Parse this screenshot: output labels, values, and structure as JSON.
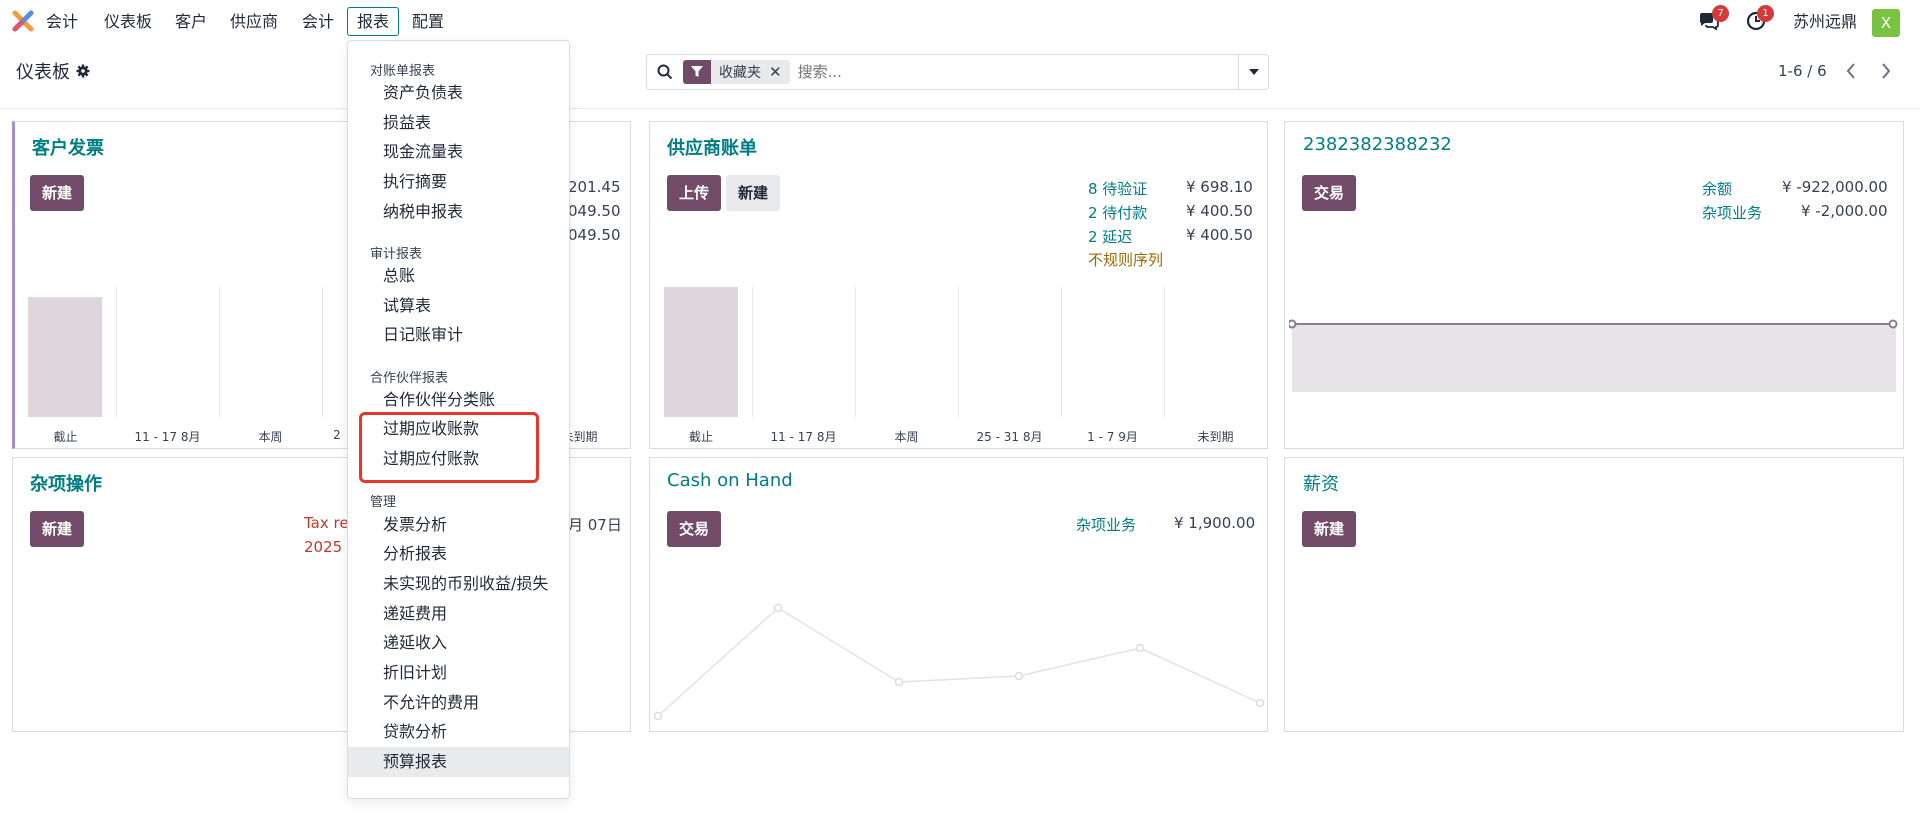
{
  "navbar": {
    "app_name": "会计",
    "menus": [
      "仪表板",
      "客户",
      "供应商",
      "会计",
      "报表",
      "配置"
    ],
    "active_menu": "报表",
    "messages_badge": "7",
    "activities_badge": "1",
    "company": "苏州远鼎",
    "avatar_letter": "X"
  },
  "breadcrumb": {
    "title": "仪表板"
  },
  "search": {
    "facet_label": "收藏夹",
    "placeholder": "搜索..."
  },
  "pager": {
    "value": "1-6 / 6"
  },
  "dropdown": {
    "sections": [
      {
        "header": "对账单报表",
        "items": [
          "资产负债表",
          "损益表",
          "现金流量表",
          "执行摘要",
          "纳税申报表"
        ]
      },
      {
        "header": "审计报表",
        "items": [
          "总账",
          "试算表",
          "日记账审计"
        ]
      },
      {
        "header": "合作伙伴报表",
        "items": [
          "合作伙伴分类账",
          "过期应收账款",
          "过期应付账款"
        ]
      },
      {
        "header": "管理",
        "items": [
          "发票分析",
          "分析报表",
          "未实现的币别收益/损失",
          "递延费用",
          "递延收入",
          "折旧计划",
          "不允许的费用",
          "贷款分析",
          "预算报表"
        ]
      }
    ]
  },
  "cards": {
    "customer_invoices": {
      "title": "客户发票",
      "new_label": "新建",
      "amounts": [
        "201.45",
        "049.50",
        "049.50"
      ],
      "chart_labels": [
        "截止",
        "11 - 17 8月",
        "本周",
        "2",
        "",
        "未到期"
      ]
    },
    "vendor_bills": {
      "title": "供应商账单",
      "upload_label": "上传",
      "new_label": "新建",
      "stats": [
        {
          "label": "8 待验证",
          "amount": "¥ 698.10"
        },
        {
          "label": "2 待付款",
          "amount": "¥ 400.50"
        },
        {
          "label": "2 延迟",
          "amount": "¥ 400.50"
        }
      ],
      "warning": "不规则序列",
      "chart_labels": [
        "截止",
        "11 - 17 8月",
        "本周",
        "25 - 31 8月",
        "1 - 7 9月",
        "未到期"
      ]
    },
    "bank": {
      "title": "2382382388232",
      "transaction_label": "交易",
      "stats": [
        {
          "label": "余额",
          "amount": "¥ -922,000.00"
        },
        {
          "label": "杂项业务",
          "amount": "¥ -2,000.00"
        }
      ]
    },
    "misc": {
      "title": "杂项操作",
      "new_label": "新建",
      "tax_text_line1": "Tax re",
      "tax_text_line2": "2025",
      "date_text": "月 07日"
    },
    "cash": {
      "title": "Cash on Hand",
      "transaction_label": "交易",
      "stat_label": "杂项业务",
      "stat_amount": "¥ 1,900.00"
    },
    "salary": {
      "title": "薪资",
      "new_label": "新建"
    }
  },
  "colors": {
    "brand": "#714b67",
    "teal": "#017e84",
    "highlight_box": "#e8362a",
    "warning": "#9a6c00"
  }
}
